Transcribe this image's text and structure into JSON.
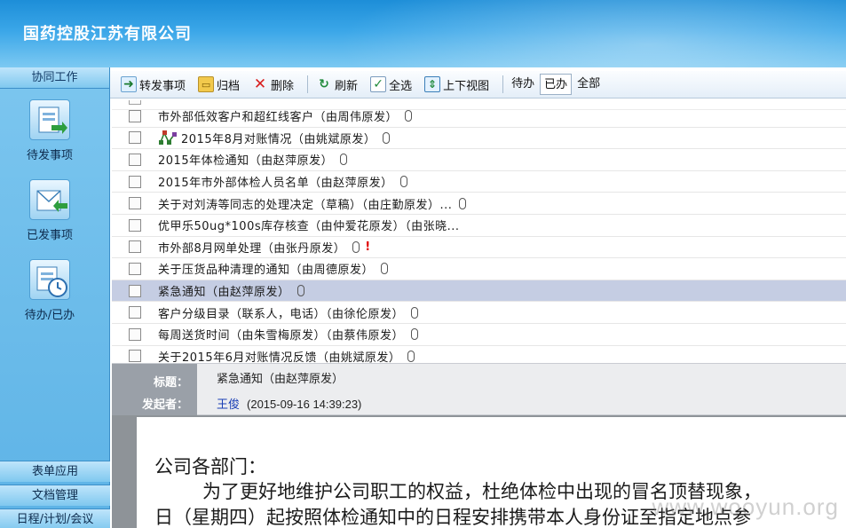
{
  "header": {
    "org_title": "国药控股江苏有限公司"
  },
  "sidebar": {
    "section_title": "协同工作",
    "items": [
      {
        "label": "待发事项",
        "icon": "pending-send-icon"
      },
      {
        "label": "已发事项",
        "icon": "sent-items-icon"
      },
      {
        "label": "待办/已办",
        "icon": "todo-done-icon"
      }
    ],
    "bottom": [
      {
        "label": "表单应用"
      },
      {
        "label": "文档管理"
      },
      {
        "label": "日程/计划/会议"
      }
    ]
  },
  "toolbar": {
    "forward": "转发事项",
    "archive": "归档",
    "delete": "删除",
    "refresh": "刷新",
    "select_all": "全选",
    "split_view": "上下视图",
    "tabs": [
      "待办",
      "已办",
      "全部"
    ],
    "active_tab": "已办"
  },
  "list": {
    "rows": [
      {
        "text": "市外部低效客户和超红线客户（由周伟原发）",
        "attach": true,
        "flow": false,
        "urgent": false,
        "selected": false
      },
      {
        "text": "2015年8月对账情况（由姚斌原发）",
        "attach": true,
        "flow": true,
        "urgent": false,
        "selected": false
      },
      {
        "text": "2015年体检通知（由赵萍原发）",
        "attach": true,
        "flow": false,
        "urgent": false,
        "selected": false
      },
      {
        "text": "2015年市外部体检人员名单（由赵萍原发）",
        "attach": true,
        "flow": false,
        "urgent": false,
        "selected": false
      },
      {
        "text": "关于对刘涛等同志的处理决定（草稿）（由庄勤原发）...",
        "attach": true,
        "flow": false,
        "urgent": false,
        "selected": false
      },
      {
        "text": "优甲乐50ug*100s库存核查（由仲爱花原发）（由张晓...",
        "attach": false,
        "flow": false,
        "urgent": false,
        "selected": false
      },
      {
        "text": "市外部8月网单处理（由张丹原发）",
        "attach": true,
        "flow": false,
        "urgent": true,
        "selected": false
      },
      {
        "text": "关于压货品种清理的通知（由周德原发）",
        "attach": true,
        "flow": false,
        "urgent": false,
        "selected": false
      },
      {
        "text": "紧急通知（由赵萍原发）",
        "attach": true,
        "flow": false,
        "urgent": false,
        "selected": true
      },
      {
        "text": "客户分级目录（联系人，电话）（由徐伦原发）",
        "attach": true,
        "flow": false,
        "urgent": false,
        "selected": false
      },
      {
        "text": "每周送货时间（由朱雪梅原发）（由蔡伟原发）",
        "attach": true,
        "flow": false,
        "urgent": false,
        "selected": false
      },
      {
        "text": "关于2015年6月对账情况反馈（由姚斌原发）",
        "attach": true,
        "flow": false,
        "urgent": false,
        "selected": false
      }
    ]
  },
  "detail": {
    "title_label": "标题：",
    "title_value": "紧急通知（由赵萍原发）",
    "sender_label": "发起者：",
    "sender_name": "王俊",
    "sent_time": "(2015-09-16 14:39:23)"
  },
  "document": {
    "line1": "公司各部门：",
    "line2": "为了更好地维护公司职工的权益，杜绝体检中出现的冒名顶替现象，",
    "line3": "日（星期四）起按照体检通知中的日程安排携带本人身份证至指定地点参",
    "watermark": "www.wooyun.org"
  },
  "colors": {
    "banner": "#2b9be0",
    "sidebar": "#6cbcea",
    "selected_row": "#c5cde3",
    "detail_label_bg": "#9aa0a8"
  }
}
